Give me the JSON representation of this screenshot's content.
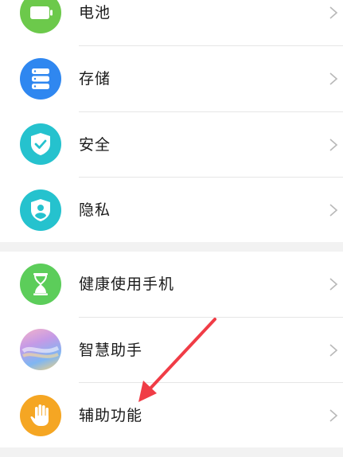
{
  "settings": {
    "group1": [
      {
        "label": "电池",
        "icon": "battery-icon",
        "color": "#6cc94b"
      },
      {
        "label": "存储",
        "icon": "storage-icon",
        "color": "#2f87f0"
      },
      {
        "label": "安全",
        "icon": "shield-check-icon",
        "color": "#25c2ce"
      },
      {
        "label": "隐私",
        "icon": "privacy-icon",
        "color": "#25c2ce"
      }
    ],
    "group2": [
      {
        "label": "健康使用手机",
        "icon": "hourglass-icon",
        "color": "#5ccd5a"
      },
      {
        "label": "智慧助手",
        "icon": "smart-assistant-icon",
        "color": "gradient"
      },
      {
        "label": "辅助功能",
        "icon": "hand-icon",
        "color": "#f5a623"
      }
    ]
  },
  "colors": {
    "annotation_arrow": "#f03c46",
    "chevron": "#b8b8b8",
    "divider": "#e6e6e6"
  }
}
